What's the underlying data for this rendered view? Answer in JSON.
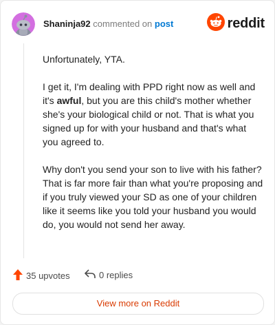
{
  "comment": {
    "username": "Shaninja92",
    "action_text": "commented on",
    "post_link": "post",
    "brand": "reddit",
    "paragraphs": [
      {
        "plain": "Unfortunately, YTA."
      },
      {
        "before": "I get it, I'm dealing with PPD right now as well and it's ",
        "bold": "awful",
        "after": ", but you are this child's mother whether she's your biological child or not. That is what you signed up for with your husband and that's what you agreed to."
      },
      {
        "plain": "Why don't you send your son to live with his father? That is far more fair than what you're proposing and if you truly viewed your SD as one of your children like it seems like you told your husband you would do, you would not send her away."
      }
    ]
  },
  "footer": {
    "upvotes": "35 upvotes",
    "replies": "0 replies",
    "view_more": "View more on Reddit"
  },
  "colors": {
    "brand_orange": "#ff4500",
    "upvote_orange": "#ff4500",
    "avatar_bg": "#d36fe0",
    "link_blue": "#0079d3",
    "view_more_text": "#d93a00"
  },
  "icons": {
    "avatar": "snoo-avatar-icon",
    "brand": "reddit-logo-icon",
    "upvote": "upvote-arrow-icon",
    "reply": "reply-arrow-icon"
  }
}
